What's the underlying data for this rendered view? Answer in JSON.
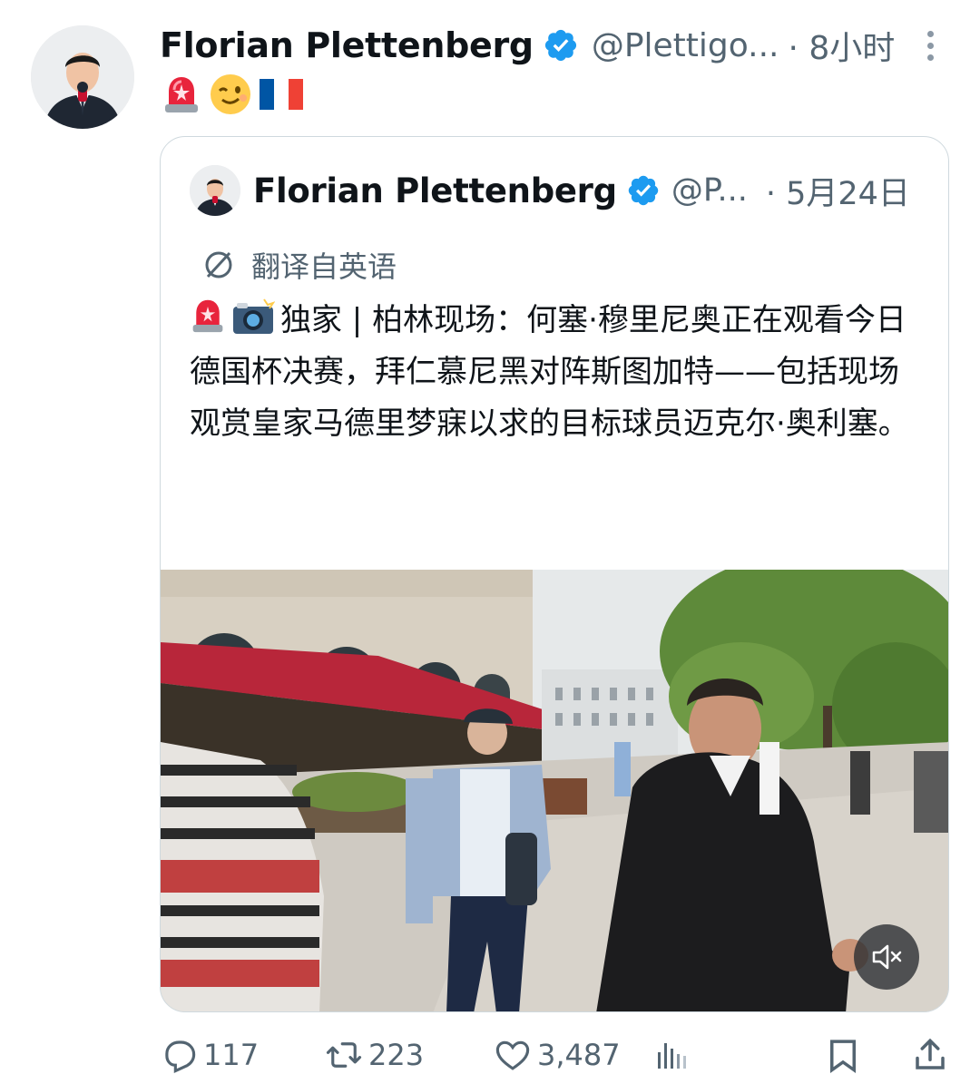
{
  "tweet": {
    "author_name": "Florian Plettenberg",
    "handle": "@Plettigo...",
    "time": "· 8小时",
    "emojis": [
      "siren-emoji",
      "wink-emoji",
      "france-flag-emoji"
    ]
  },
  "quoted": {
    "author_name": "Florian Plettenberg",
    "handle": "@P...",
    "time": "· 5月24日",
    "translated_label": "翻译自英语",
    "text": "独家 | 柏林现场：何塞·穆里尼奥正在观看今日德国杯决赛，拜仁慕尼黑对阵斯图加特——包括现场观赏皇家马德里梦寐以求的目标球员迈克尔·奥利塞。",
    "ellipsis": "…"
  },
  "actions": {
    "replies": "117",
    "reposts": "223",
    "likes": "3,487"
  },
  "colors": {
    "verified": "#1d9bf0",
    "secondary_text": "#536471",
    "border": "#cfd9de"
  }
}
